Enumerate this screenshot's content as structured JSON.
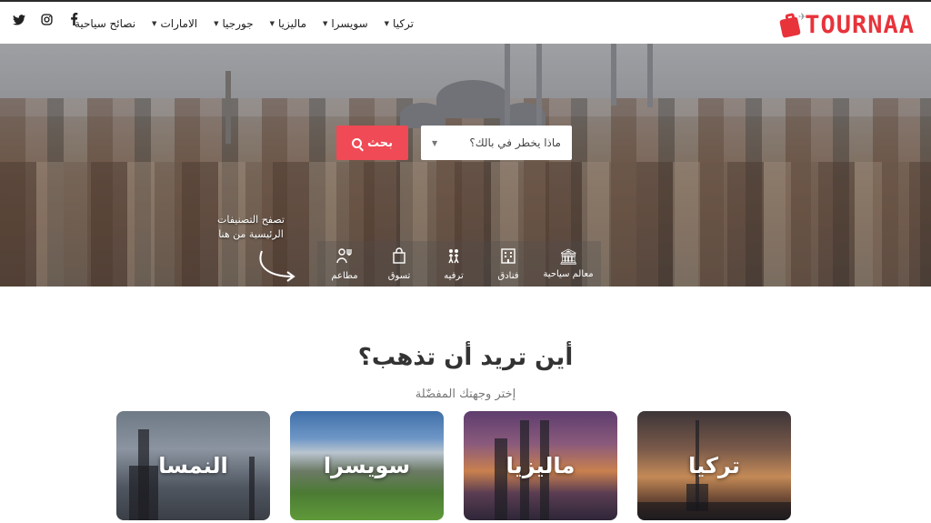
{
  "brand": {
    "name": "TOURNAA",
    "color": "#e8333b"
  },
  "nav": {
    "items": [
      {
        "label": "تركيا",
        "has_dropdown": true
      },
      {
        "label": "سويسرا",
        "has_dropdown": true
      },
      {
        "label": "ماليزيا",
        "has_dropdown": true
      },
      {
        "label": "جورجيا",
        "has_dropdown": true
      },
      {
        "label": "الامارات",
        "has_dropdown": true
      },
      {
        "label": "نصائح سياحية",
        "has_dropdown": false
      }
    ],
    "caret_glyph": "▼"
  },
  "social": {
    "icons": [
      "twitter-icon",
      "instagram-icon",
      "facebook-icon"
    ]
  },
  "search": {
    "placeholder": "ماذا يخطر في بالك؟",
    "button_label": "بحث",
    "accent": "#ef4a55"
  },
  "browse_hint": {
    "line1": "تصفح التصنيفات",
    "line2": "الرئيسية من هنا"
  },
  "categories": [
    {
      "label": "معالم سياحية",
      "icon": "landmark-icon"
    },
    {
      "label": "فنادق",
      "icon": "hotel-icon"
    },
    {
      "label": "ترفيه",
      "icon": "entertainment-icon"
    },
    {
      "label": "تسوق",
      "icon": "shopping-bag-icon"
    },
    {
      "label": "مطاعم",
      "icon": "restaurant-icon"
    }
  ],
  "destinations": {
    "title": "أين تريد أن تذهب؟",
    "subtitle": "إختر وجهتك المفضّلة",
    "cards": [
      {
        "name": "النمسا"
      },
      {
        "name": "سويسرا"
      },
      {
        "name": "ماليزيا"
      },
      {
        "name": "تركيا"
      }
    ]
  }
}
